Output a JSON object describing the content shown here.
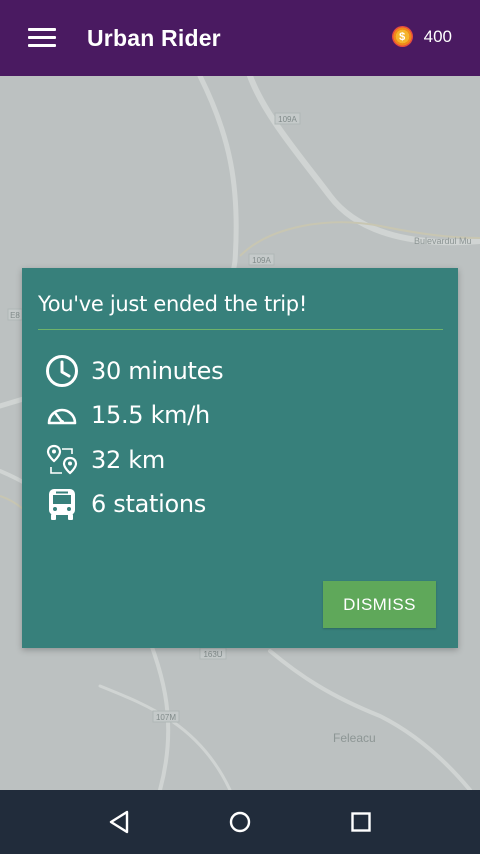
{
  "app": {
    "title": "Urban Rider",
    "coins": "400",
    "coin_symbol": "$"
  },
  "map": {
    "labels": [
      "109A",
      "109A",
      "Bulevardul Mu",
      "163U",
      "107M",
      "Feleacu",
      "E8"
    ]
  },
  "dialog": {
    "title": "You've just ended the trip!",
    "stats": [
      {
        "icon": "clock-icon",
        "value": "30 minutes"
      },
      {
        "icon": "speedometer-icon",
        "value": "15.5 km/h"
      },
      {
        "icon": "route-pins-icon",
        "value": "32 km"
      },
      {
        "icon": "bus-icon",
        "value": "6 stations"
      }
    ],
    "dismiss_label": "DISMISS"
  },
  "colors": {
    "appbar": "#4a1a61",
    "dialog": "#37807b",
    "accent": "#5fa85a",
    "navbar": "#212c3b"
  },
  "navbar": {
    "buttons": [
      "back-icon",
      "home-icon",
      "recents-icon"
    ]
  }
}
